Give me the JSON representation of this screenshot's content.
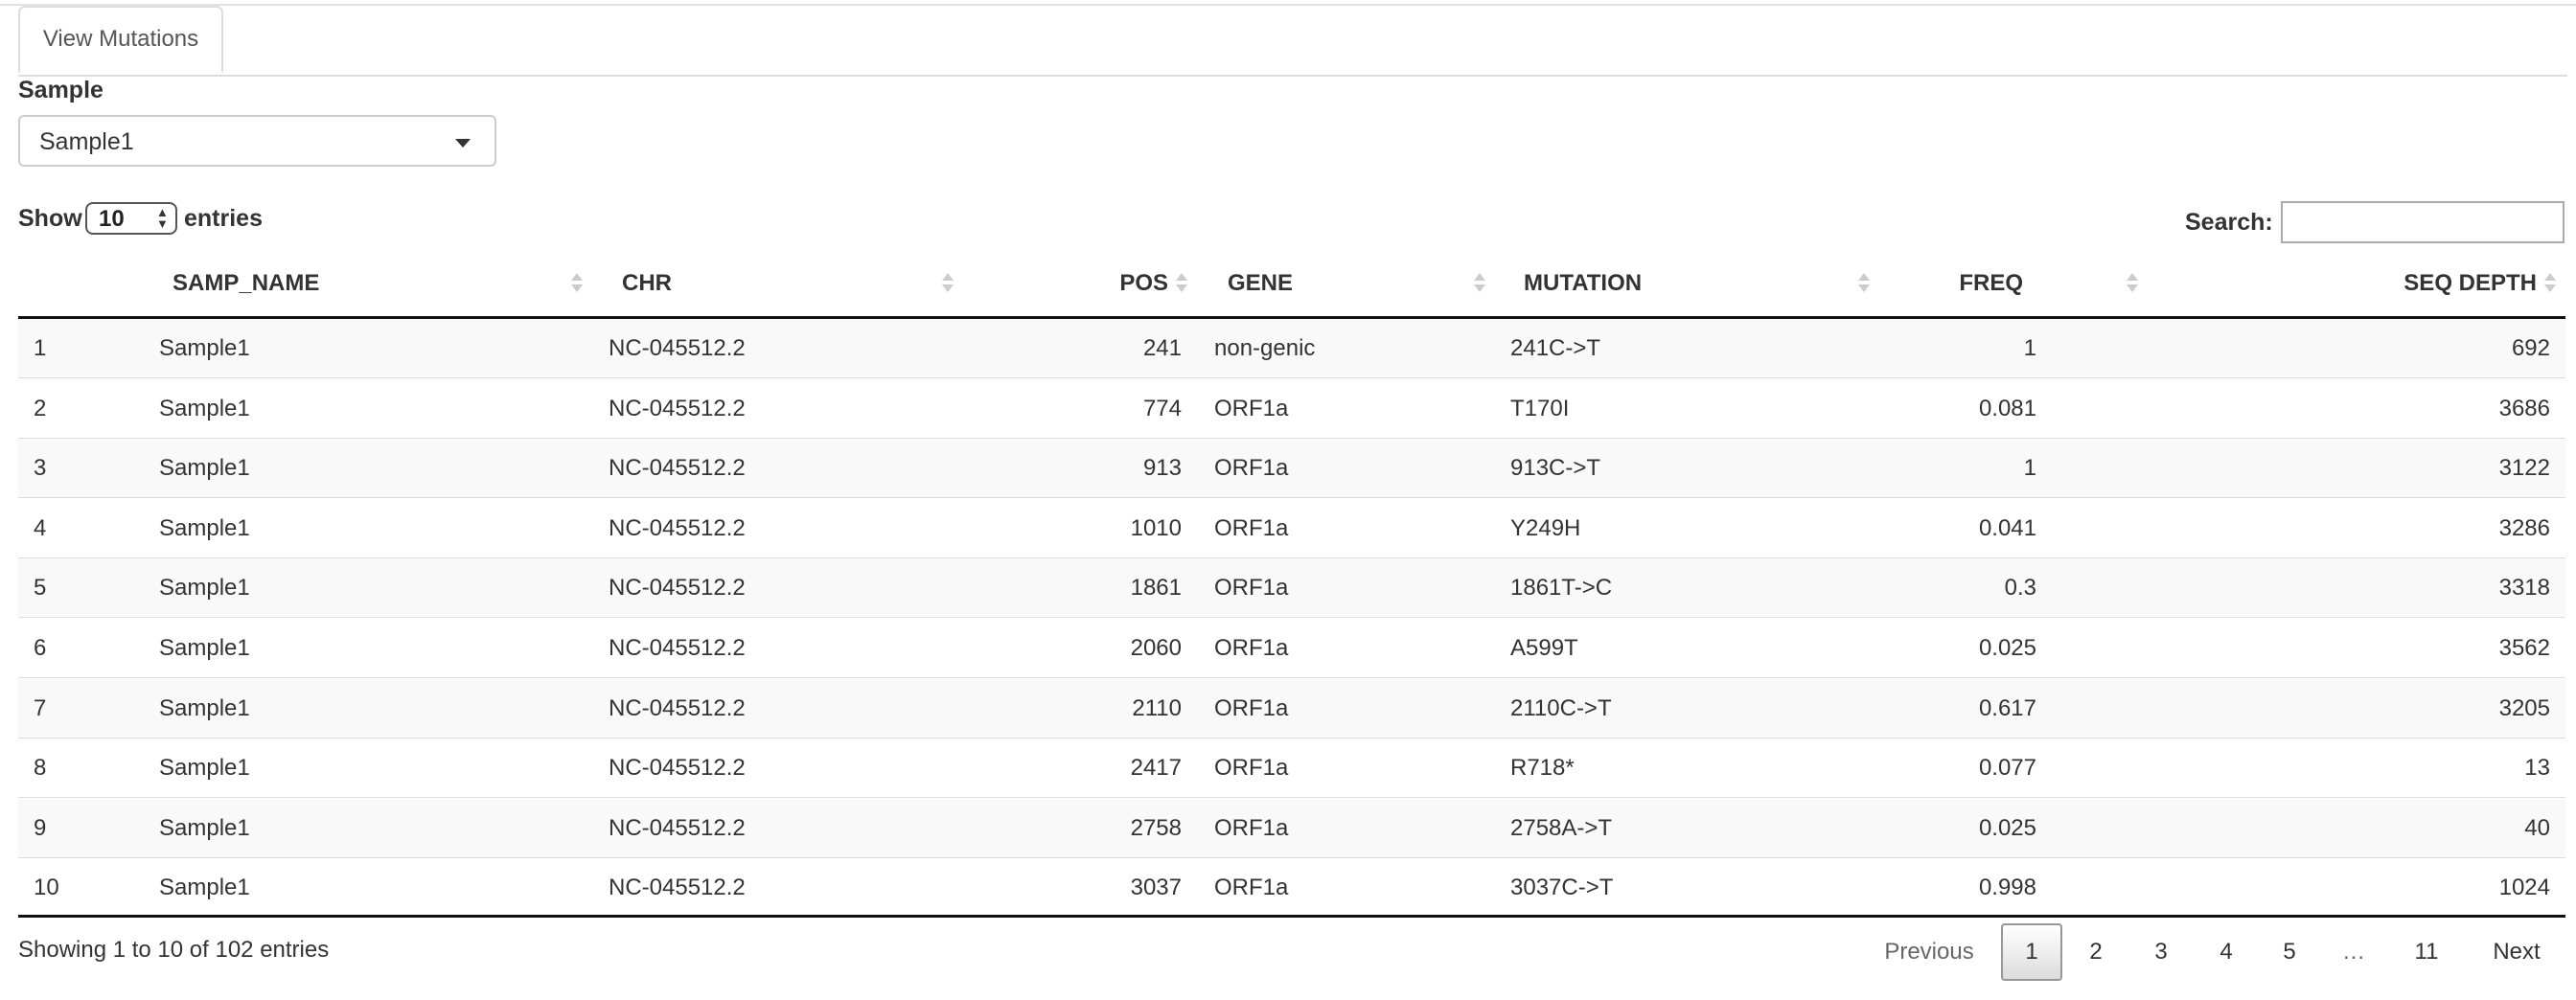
{
  "tabs": [
    {
      "label": "View Mutations"
    }
  ],
  "sample": {
    "label": "Sample",
    "selected": "Sample1"
  },
  "length": {
    "show": "Show",
    "value": "10",
    "entries": "entries"
  },
  "search": {
    "label": "Search:",
    "value": ""
  },
  "table": {
    "columns": [
      "SAMP_NAME",
      "CHR",
      "POS",
      "GENE",
      "MUTATION",
      "FREQ",
      "SEQ DEPTH"
    ],
    "rows": [
      {
        "idx": "1",
        "samp": "Sample1",
        "chr": "NC-045512.2",
        "pos": "241",
        "gene": "non-genic",
        "mut": "241C->T",
        "freq": "1",
        "depth": "692"
      },
      {
        "idx": "2",
        "samp": "Sample1",
        "chr": "NC-045512.2",
        "pos": "774",
        "gene": "ORF1a",
        "mut": "T170I",
        "freq": "0.081",
        "depth": "3686"
      },
      {
        "idx": "3",
        "samp": "Sample1",
        "chr": "NC-045512.2",
        "pos": "913",
        "gene": "ORF1a",
        "mut": "913C->T",
        "freq": "1",
        "depth": "3122"
      },
      {
        "idx": "4",
        "samp": "Sample1",
        "chr": "NC-045512.2",
        "pos": "1010",
        "gene": "ORF1a",
        "mut": "Y249H",
        "freq": "0.041",
        "depth": "3286"
      },
      {
        "idx": "5",
        "samp": "Sample1",
        "chr": "NC-045512.2",
        "pos": "1861",
        "gene": "ORF1a",
        "mut": "1861T->C",
        "freq": "0.3",
        "depth": "3318"
      },
      {
        "idx": "6",
        "samp": "Sample1",
        "chr": "NC-045512.2",
        "pos": "2060",
        "gene": "ORF1a",
        "mut": "A599T",
        "freq": "0.025",
        "depth": "3562"
      },
      {
        "idx": "7",
        "samp": "Sample1",
        "chr": "NC-045512.2",
        "pos": "2110",
        "gene": "ORF1a",
        "mut": "2110C->T",
        "freq": "0.617",
        "depth": "3205"
      },
      {
        "idx": "8",
        "samp": "Sample1",
        "chr": "NC-045512.2",
        "pos": "2417",
        "gene": "ORF1a",
        "mut": "R718*",
        "freq": "0.077",
        "depth": "13"
      },
      {
        "idx": "9",
        "samp": "Sample1",
        "chr": "NC-045512.2",
        "pos": "2758",
        "gene": "ORF1a",
        "mut": "2758A->T",
        "freq": "0.025",
        "depth": "40"
      },
      {
        "idx": "10",
        "samp": "Sample1",
        "chr": "NC-045512.2",
        "pos": "3037",
        "gene": "ORF1a",
        "mut": "3037C->T",
        "freq": "0.998",
        "depth": "1024"
      }
    ]
  },
  "info": "Showing 1 to 10 of 102 entries",
  "pagination": {
    "previous": "Previous",
    "pages": [
      "1",
      "2",
      "3",
      "4",
      "5",
      "…",
      "11"
    ],
    "current": "1",
    "next": "Next"
  }
}
